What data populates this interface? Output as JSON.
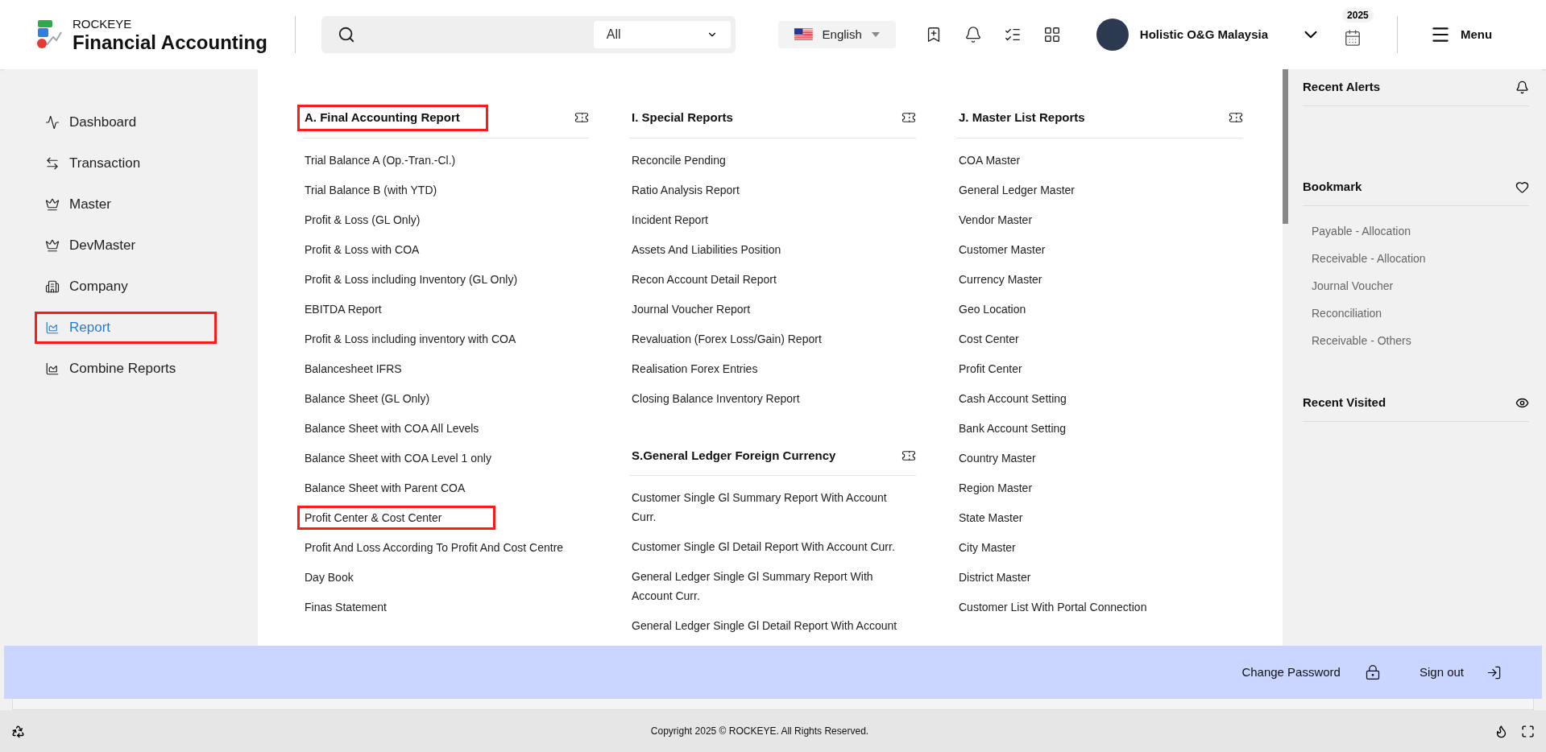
{
  "header": {
    "brand": "ROCKEYE",
    "app_title": "Financial Accounting",
    "search": {
      "category": "All"
    },
    "language": "English",
    "user_name": "Holistic O&G Malaysia",
    "year_badge": "2025",
    "menu_label": "Menu"
  },
  "sidebar": {
    "items": [
      {
        "label": "Dashboard",
        "selected": false,
        "highlighted": false
      },
      {
        "label": "Transaction",
        "selected": false,
        "highlighted": false
      },
      {
        "label": "Master",
        "selected": false,
        "highlighted": false
      },
      {
        "label": "DevMaster",
        "selected": false,
        "highlighted": false
      },
      {
        "label": "Company",
        "selected": false,
        "highlighted": false
      },
      {
        "label": "Report",
        "selected": true,
        "highlighted": true
      },
      {
        "label": "Combine Reports",
        "selected": false,
        "highlighted": false
      }
    ]
  },
  "report_columns": [
    {
      "sections": [
        {
          "title": "A. Final Accounting Report",
          "highlighted": true,
          "items": [
            {
              "label": "Trial Balance A (Op.-Tran.-Cl.)",
              "highlighted": false
            },
            {
              "label": "Trial Balance B (with YTD)",
              "highlighted": false
            },
            {
              "label": "Profit & Loss (GL Only)",
              "highlighted": false
            },
            {
              "label": "Profit & Loss with COA",
              "highlighted": false
            },
            {
              "label": "Profit & Loss including Inventory (GL Only)",
              "highlighted": false
            },
            {
              "label": "EBITDA Report",
              "highlighted": false
            },
            {
              "label": "Profit & Loss including inventory with COA",
              "highlighted": false
            },
            {
              "label": "Balancesheet IFRS",
              "highlighted": false
            },
            {
              "label": "Balance Sheet (GL Only)",
              "highlighted": false
            },
            {
              "label": "Balance Sheet with COA All Levels",
              "highlighted": false
            },
            {
              "label": "Balance Sheet with COA Level 1 only",
              "highlighted": false
            },
            {
              "label": "Balance Sheet with Parent COA",
              "highlighted": false
            },
            {
              "label": "Profit Center & Cost Center",
              "highlighted": true
            },
            {
              "label": "Profit And Loss According To Profit And Cost Centre",
              "highlighted": false
            },
            {
              "label": "Day Book",
              "highlighted": false
            },
            {
              "label": "Finas Statement",
              "highlighted": false
            }
          ]
        }
      ]
    },
    {
      "sections": [
        {
          "title": "I. Special Reports",
          "highlighted": false,
          "items": [
            {
              "label": "Reconcile Pending",
              "highlighted": false
            },
            {
              "label": "Ratio Analysis Report",
              "highlighted": false
            },
            {
              "label": "Incident Report",
              "highlighted": false
            },
            {
              "label": "Assets And Liabilities Position",
              "highlighted": false
            },
            {
              "label": "Recon Account Detail Report",
              "highlighted": false
            },
            {
              "label": "Journal Voucher Report",
              "highlighted": false
            },
            {
              "label": "Revaluation (Forex Loss/Gain) Report",
              "highlighted": false
            },
            {
              "label": "Realisation Forex Entries",
              "highlighted": false
            },
            {
              "label": "Closing Balance Inventory Report",
              "highlighted": false
            }
          ]
        },
        {
          "title": "S.General Ledger Foreign Currency",
          "highlighted": false,
          "items": [
            {
              "label": "Customer Single Gl Summary Report With Account Curr.",
              "highlighted": false
            },
            {
              "label": "Customer Single Gl Detail Report With Account Curr.",
              "highlighted": false
            },
            {
              "label": "General Ledger Single Gl Summary Report With Account Curr.",
              "highlighted": false
            },
            {
              "label": "General Ledger Single Gl Detail Report With Account",
              "highlighted": false
            }
          ]
        }
      ]
    },
    {
      "sections": [
        {
          "title": "J. Master List Reports",
          "highlighted": false,
          "items": [
            {
              "label": "COA Master",
              "highlighted": false
            },
            {
              "label": "General Ledger Master",
              "highlighted": false
            },
            {
              "label": "Vendor Master",
              "highlighted": false
            },
            {
              "label": "Customer Master",
              "highlighted": false
            },
            {
              "label": "Currency Master",
              "highlighted": false
            },
            {
              "label": "Geo Location",
              "highlighted": false
            },
            {
              "label": "Cost Center",
              "highlighted": false
            },
            {
              "label": "Profit Center",
              "highlighted": false
            },
            {
              "label": "Cash Account Setting",
              "highlighted": false
            },
            {
              "label": "Bank Account Setting",
              "highlighted": false
            },
            {
              "label": "Country Master",
              "highlighted": false
            },
            {
              "label": "Region Master",
              "highlighted": false
            },
            {
              "label": "State Master",
              "highlighted": false
            },
            {
              "label": "City Master",
              "highlighted": false
            },
            {
              "label": "District Master",
              "highlighted": false
            },
            {
              "label": "Customer List With Portal Connection",
              "highlighted": false
            }
          ]
        }
      ]
    }
  ],
  "right_panel": {
    "recent_alerts_title": "Recent Alerts",
    "bookmark_title": "Bookmark",
    "bookmarks": [
      "Payable - Allocation",
      "Receivable - Allocation",
      "Journal Voucher",
      "Reconciliation",
      "Receivable - Others"
    ],
    "recent_visited_title": "Recent Visited"
  },
  "account_bar": {
    "change_password": "Change Password",
    "sign_out": "Sign out"
  },
  "footer": {
    "copyright": "Copyright 2025 © ROCKEYE. All Rights Reserved."
  }
}
